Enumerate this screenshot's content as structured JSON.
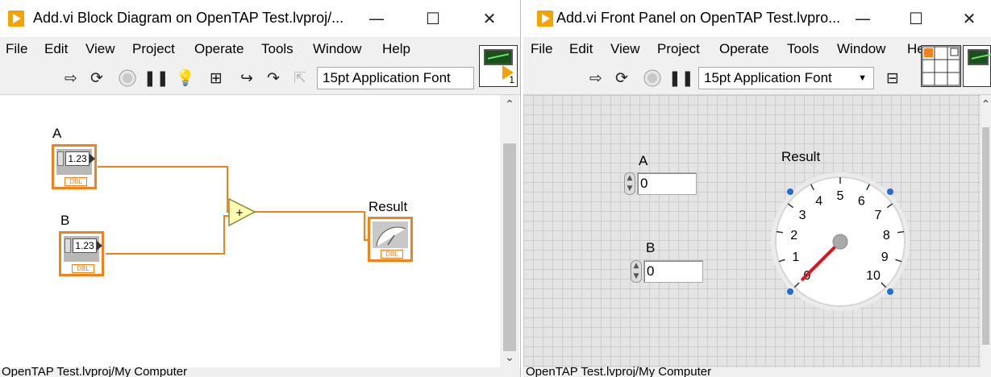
{
  "block_diagram": {
    "title": "Add.vi Block Diagram on OpenTAP Test.lvproj/...",
    "menu": [
      "File",
      "Edit",
      "View",
      "Project",
      "Operate",
      "Tools",
      "Window",
      "Help"
    ],
    "font_select": "15pt Application Font",
    "vi_icon_number": "1",
    "nodes": {
      "a": {
        "label": "A",
        "value": "1.23",
        "type": "DBL"
      },
      "b": {
        "label": "B",
        "value": "1.23",
        "type": "DBL"
      },
      "add": {
        "symbol": "+"
      },
      "result": {
        "label": "Result",
        "type": "DBL"
      }
    },
    "status": "OpenTAP Test.lvproj/My Computer"
  },
  "front_panel": {
    "title": "Add.vi Front Panel on OpenTAP Test.lvpro...",
    "menu": [
      "File",
      "Edit",
      "View",
      "Project",
      "Operate",
      "Tools",
      "Window",
      "He"
    ],
    "font_select": "15pt Application Font",
    "controls": {
      "a": {
        "label": "A",
        "value": "0"
      },
      "b": {
        "label": "B",
        "value": "0"
      }
    },
    "gauge": {
      "label": "Result",
      "ticks": [
        "0",
        "1",
        "2",
        "3",
        "4",
        "5",
        "6",
        "7",
        "8",
        "9",
        "10"
      ],
      "value": 0,
      "needle_color": "#e8101a"
    },
    "status": "OpenTAP Test.lvproj/My Computer"
  },
  "window_buttons": {
    "minimize": "—",
    "maximize": "☐",
    "close": "✕"
  },
  "colors": {
    "wire": "#f0821e",
    "terminal_border": "#f0821e",
    "add_node": "#fffbb0"
  }
}
